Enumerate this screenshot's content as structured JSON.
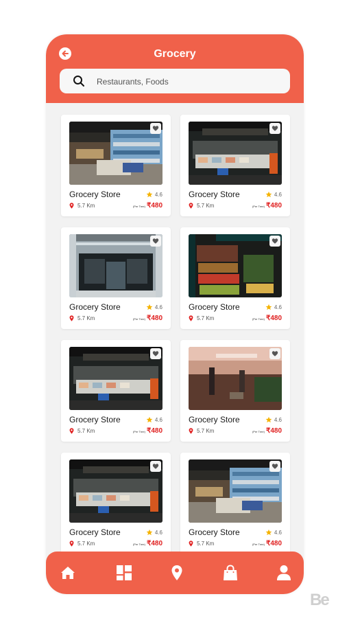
{
  "header": {
    "title": "Grocery"
  },
  "search": {
    "placeholder": "Restaurants, Foods"
  },
  "cards": [
    {
      "name": "Grocery Store",
      "rating": "4.6",
      "distance": "5.7 Km",
      "per": "(Per Tree)",
      "price": "₹480",
      "photo": "aisle"
    },
    {
      "name": "Grocery Store",
      "rating": "4.6",
      "distance": "5.7 Km",
      "per": "(Per Tree)",
      "price": "₹480",
      "photo": "stall"
    },
    {
      "name": "Grocery Store",
      "rating": "4.6",
      "distance": "5.7 Km",
      "per": "(Per Tree)",
      "price": "₹480",
      "photo": "front"
    },
    {
      "name": "Grocery Store",
      "rating": "4.6",
      "distance": "5.7 Km",
      "per": "(Per Tree)",
      "price": "₹480",
      "photo": "fruit"
    },
    {
      "name": "Grocery Store",
      "rating": "4.6",
      "distance": "5.7 Km",
      "per": "(Per Tree)",
      "price": "₹480",
      "photo": "stall"
    },
    {
      "name": "Grocery Store",
      "rating": "4.6",
      "distance": "5.7 Km",
      "per": "(Per Tree)",
      "price": "₹480",
      "photo": "shop"
    },
    {
      "name": "Grocery Store",
      "rating": "4.6",
      "distance": "5.7 Km",
      "per": "(Per Tree)",
      "price": "₹480",
      "photo": "stall"
    },
    {
      "name": "Grocery Store",
      "rating": "4.6",
      "distance": "5.7 Km",
      "per": "(Per Tree)",
      "price": "₹480",
      "photo": "aisle"
    }
  ],
  "nav": [
    {
      "icon": "home-icon"
    },
    {
      "icon": "categories-icon"
    },
    {
      "icon": "location-icon"
    },
    {
      "icon": "bag-icon"
    },
    {
      "icon": "profile-icon"
    }
  ],
  "watermark": "Be",
  "colors": {
    "accent": "#f0614a",
    "price": "#e02020",
    "star": "#f5b301"
  }
}
